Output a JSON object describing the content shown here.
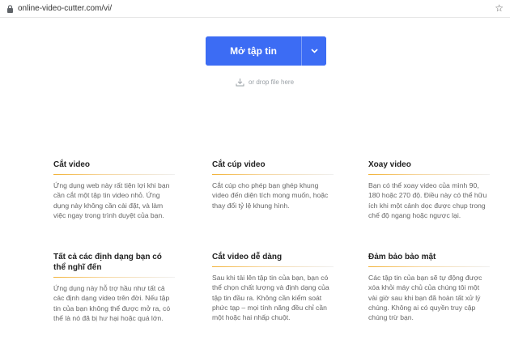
{
  "browser": {
    "url": "online-video-cutter.com/vi/"
  },
  "upload": {
    "open_label": "Mở tập tin",
    "drop_text": "or drop file here"
  },
  "features": [
    {
      "title": "Cắt video",
      "desc": "Ứng dụng web này rất tiện lợi khi bạn cần cắt một tập tin video nhỏ. Ứng dụng này không cần cài đặt, và làm việc ngay trong trình duyệt của bạn."
    },
    {
      "title": "Cắt cúp video",
      "desc": "Cắt cúp cho phép bạn ghép khung video đến diện tích mong muốn, hoặc thay đổi tỷ lệ khung hình."
    },
    {
      "title": "Xoay video",
      "desc": "Bạn có thể xoay video của mình 90, 180 hoặc 270 độ. Điều này có thể hữu ích khi một cảnh dọc được chụp trong chế độ ngang hoặc ngược lại."
    },
    {
      "title": "Tất cả các định dạng bạn có thể nghĩ đến",
      "desc": "Ứng dụng này hỗ trợ hầu như tất cả các định dạng video trên đời. Nếu tập tin của bạn không thể được mở ra, có thể là nó đã bị hư hại hoặc quá lớn."
    },
    {
      "title": "Cắt video dễ dàng",
      "desc": "Sau khi tải lên tập tin của bạn, bạn có thể chọn chất lượng và định dạng của tập tin đầu ra. Không cần kiểm soát phức tạp – mọi tính năng đều chỉ cần một hoặc hai nhấp chuột."
    },
    {
      "title": "Đảm bảo bảo mật",
      "desc": "Các tập tin của bạn sẽ tự động được xóa khỏi máy chủ của chúng tôi một vài giờ sau khi bạn đã hoàn tất xử lý chúng. Không ai có quyền truy cập chúng trừ bạn."
    }
  ],
  "colors": {
    "primary": "#3c6cf4",
    "underline_accent": "#f2b134"
  }
}
